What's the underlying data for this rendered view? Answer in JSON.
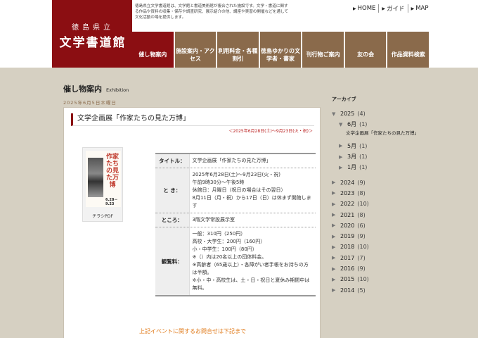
{
  "header": {
    "logo_seal": "徳島県立",
    "logo_brand": "文学書道館",
    "intro": "徳島県立文学書道館は、文学館と書道美術館が複合された施設です。文学・書道に関する作品や資料の収集・保存や調査研究、展示紹介の他、講座や実習の開催などを通して文化活動の場を提供します。",
    "util_nav": [
      "HOME",
      "ガイド",
      "MAP"
    ]
  },
  "main_nav": [
    {
      "label": "催し物案内",
      "active": true
    },
    {
      "label": "施設案内・アクセス",
      "active": false
    },
    {
      "label": "利用料金・各種割引",
      "active": false
    },
    {
      "label": "徳島ゆかりの文学者・書家",
      "active": false
    },
    {
      "label": "刊行物ご案内",
      "active": false
    },
    {
      "label": "友の会",
      "active": false
    },
    {
      "label": "作品資料検索",
      "active": false
    }
  ],
  "page": {
    "title": "催し物案内",
    "subtitle": "Exhibition",
    "date": "2025年6月5日木曜日"
  },
  "event": {
    "title": "文学企画展「作家たちの見た万博」",
    "period": "＜2025年6月28日(土)～9月23日(火・祝)＞",
    "flyer_caption": "チラシPDF",
    "flyer_title": "作家たちの見た万博",
    "flyer_date": "6.28－9.23",
    "info": [
      {
        "label": "タイトル：",
        "value": "文学企画展「作家たちの見た万博」"
      },
      {
        "label": "と き：",
        "value": "2025年6月28日(土)～9月23日(火・祝)\n午前9時30分～午後5時\n休館日：月曜日（祝日の場合はその翌日）\n8月11日（月・祝）から17日（日）は休まず開館します"
      },
      {
        "label": "ところ：",
        "value": "3階文学常設展示室"
      },
      {
        "label": "観覧料：",
        "value": "一般：310円（250円）\n高校・大学生：200円（160円）\n小・中学生：100円（80円）\n※（）内は20名以上の団体料金。\n※高齢者（65歳以上）・各障がい者手帳をお持ちの方は半額。\n※小・中・高校生は、土・日・祝日と夏休み期間中は無料。"
      }
    ],
    "contact_note": "上記イベントに関するお問合せは下記まで"
  },
  "sidebar": {
    "title": "アーカイブ",
    "items": [
      {
        "label": "2025",
        "count": "(4)",
        "level": 1,
        "open": true
      },
      {
        "label": "6月",
        "count": "(1)",
        "level": 2,
        "open": true
      },
      {
        "label": "5月",
        "count": "(1)",
        "level": 2,
        "open": false
      },
      {
        "label": "3月",
        "count": "(1)",
        "level": 2,
        "open": false
      },
      {
        "label": "1月",
        "count": "(1)",
        "level": 2,
        "open": false
      },
      {
        "label": "2024",
        "count": "(9)",
        "level": 1,
        "open": false
      },
      {
        "label": "2023",
        "count": "(8)",
        "level": 1,
        "open": false
      },
      {
        "label": "2022",
        "count": "(10)",
        "level": 1,
        "open": false
      },
      {
        "label": "2021",
        "count": "(8)",
        "level": 1,
        "open": false
      },
      {
        "label": "2020",
        "count": "(6)",
        "level": 1,
        "open": false
      },
      {
        "label": "2019",
        "count": "(9)",
        "level": 1,
        "open": false
      },
      {
        "label": "2018",
        "count": "(10)",
        "level": 1,
        "open": false
      },
      {
        "label": "2017",
        "count": "(7)",
        "level": 1,
        "open": false
      },
      {
        "label": "2016",
        "count": "(9)",
        "level": 1,
        "open": false
      },
      {
        "label": "2015",
        "count": "(10)",
        "level": 1,
        "open": false
      },
      {
        "label": "2014",
        "count": "(5)",
        "level": 1,
        "open": false
      }
    ],
    "sub_event": "文学企画展「作家たちの見た万博」"
  }
}
